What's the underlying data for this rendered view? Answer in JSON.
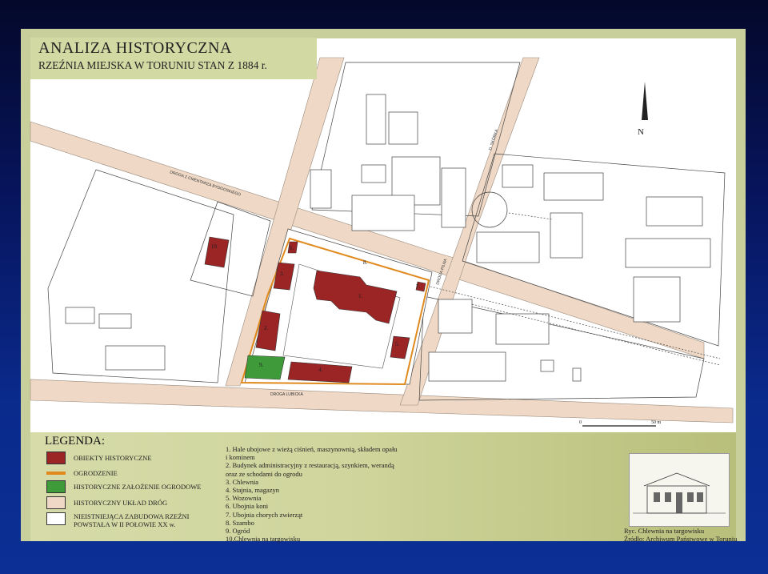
{
  "title": {
    "main": "ANALIZA HISTORYCZNA",
    "sub": "RZEŹNIA MIEJSKA W TORUNIU STAN Z 1884 r."
  },
  "map": {
    "north_label": "N",
    "scale_start": "0",
    "scale_end": "50 m",
    "roads": {
      "top_left": "DROGA Z CMENTARZA BYDGOSKIEGO",
      "bottom": "DROGA LUBICKA",
      "right_vertical": "D. SKÓRKA",
      "middle_vertical": "DROGA PILNA"
    },
    "building_numbers": [
      "1.",
      "2.",
      "3.",
      "4.",
      "5.",
      "6.",
      "7.",
      "8.",
      "9.",
      "10."
    ]
  },
  "legend": {
    "title": "LEGENDA:",
    "items": [
      {
        "label": "OBIEKTY HISTORYCZNE",
        "color": "#9b2424",
        "kind": "box"
      },
      {
        "label": "OGRODZENIE",
        "color": "#e08a1e",
        "kind": "line"
      },
      {
        "label": "HISTORYCZNE ZAŁOŻENIE OGRODOWE",
        "color": "#3f9a3a",
        "kind": "box"
      },
      {
        "label": "HISTORYCZNY UKŁAD DRÓG",
        "color": "#efd9c6",
        "kind": "box"
      },
      {
        "label": "NIEISTNIEJĄCA ZABUDOWA RZEŹNI",
        "label2": "POWSTAŁA W II POŁOWIE XX w.",
        "color": "#ffffff",
        "kind": "box"
      }
    ]
  },
  "objects": [
    "1.   Hale ubojowe z wieżą ciśnień, maszynownią, składem opału",
    "       i kominem",
    "2.  Budynek administracyjny z restauracją, szynkiem, werandą",
    "       oraz ze schodami do ogrodu",
    "3.  Chlewnia",
    "4.  Stajnia, magazyn",
    "5.  Wozownia",
    "6.  Ubojnia koni",
    "7.  Ubojnia chorych zwierząt",
    "8.  Szambo",
    "9.  Ogród",
    "10.Chlewnia na targowisku"
  ],
  "inset": {
    "caption1": "Ryc. Chlewnia na targowisku",
    "caption2": "Źródło: Archiwum Państwowe w Toruniu"
  },
  "colors": {
    "historic": "#9b2424",
    "fence": "#e08a1e",
    "garden": "#3f9a3a",
    "roads": "#efd9c6",
    "panel": "#d3d9a3"
  }
}
